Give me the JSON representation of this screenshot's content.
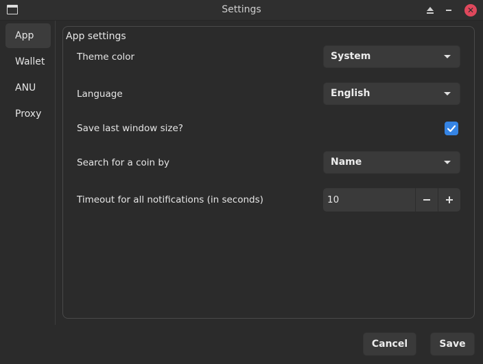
{
  "window": {
    "title": "Settings"
  },
  "sidebar": {
    "items": [
      {
        "label": "App",
        "active": true
      },
      {
        "label": "Wallet",
        "active": false
      },
      {
        "label": "ANU",
        "active": false
      },
      {
        "label": "Proxy",
        "active": false
      }
    ]
  },
  "app_settings": {
    "title": "App settings",
    "theme_color": {
      "label": "Theme color",
      "value": "System"
    },
    "language": {
      "label": "Language",
      "value": "English"
    },
    "save_window_size": {
      "label": "Save last window size?",
      "checked": true
    },
    "search_coin": {
      "label": "Search for a coin by",
      "value": "Name"
    },
    "timeout": {
      "label": "Timeout for all notifications (in seconds)",
      "value": "10"
    }
  },
  "actions": {
    "cancel_label": "Cancel",
    "save_label": "Save"
  },
  "colors": {
    "background": "#2b2b2b",
    "accent": "#3584e4",
    "close": "#e0485c"
  }
}
